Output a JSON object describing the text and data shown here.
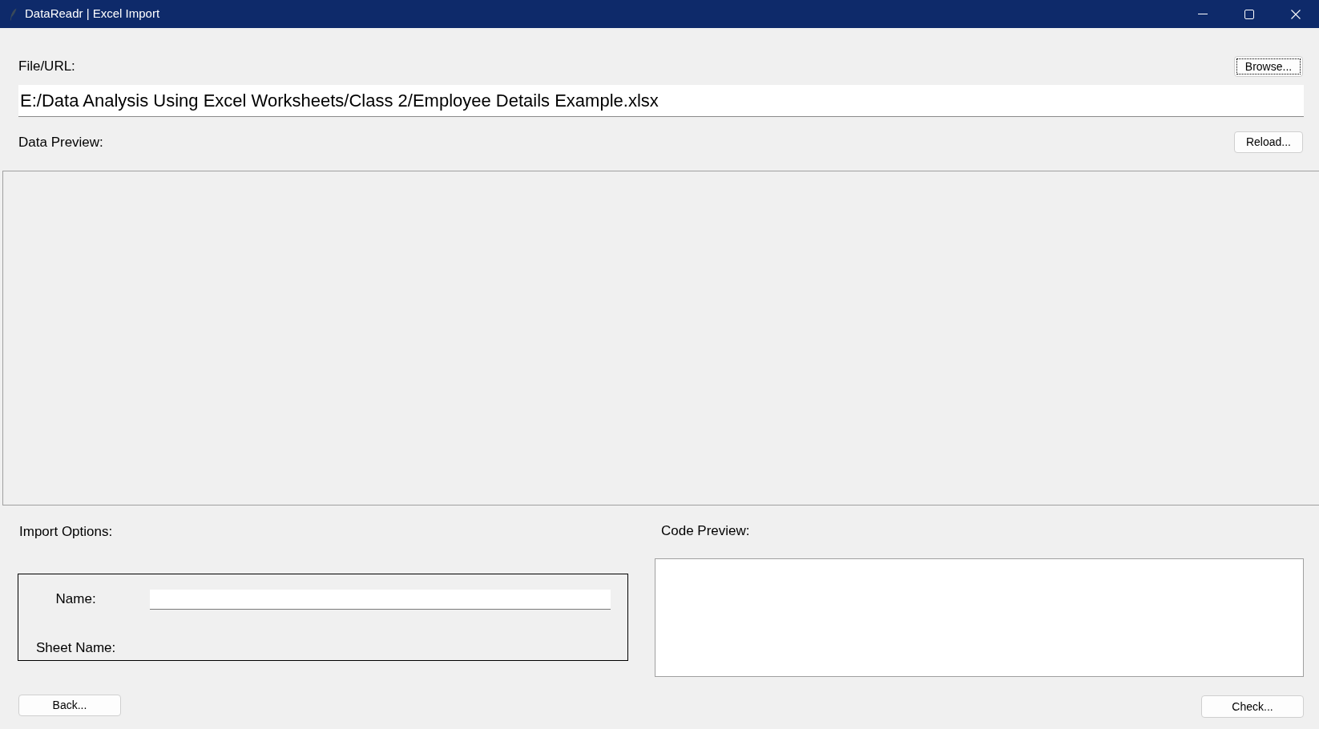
{
  "window": {
    "title": "DataReadr | Excel Import"
  },
  "file": {
    "label": "File/URL:",
    "browse_button": {
      "label": "Browse...",
      "focused": true
    },
    "value": "E:/Data Analysis Using Excel Worksheets/Class 2/Employee Details Example.xlsx"
  },
  "data_preview": {
    "label": "Data Preview:",
    "reload_button": "Reload..."
  },
  "import_options": {
    "label": "Import Options:",
    "fields": [
      {
        "label": "Name:",
        "kind": "entry"
      },
      {
        "label": "Sheet Name:",
        "kind": "plain"
      }
    ]
  },
  "code_preview": {
    "label": "Code Preview:"
  },
  "buttons": {
    "back": "Back...",
    "check": "Check..."
  }
}
